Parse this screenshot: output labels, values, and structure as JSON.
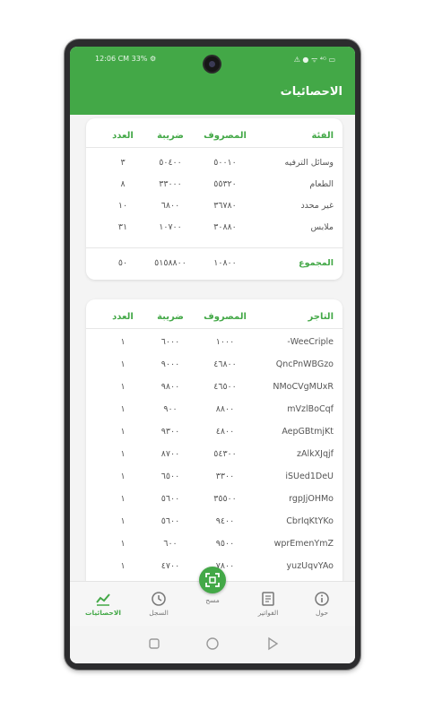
{
  "status": {
    "left": "12:06 CM 33% ⚙",
    "right": "⚠ ● ᯤ ⁴ᴳ ▭"
  },
  "appbar": {
    "title": "الاحصائيات"
  },
  "categories": {
    "headers": {
      "category": "الفئة",
      "expense": "المصروف",
      "tax": "ضريبة",
      "count": "العدد"
    },
    "rows": [
      {
        "category": "وسائل الترفيه",
        "expense": "٥٠٠١٠",
        "tax": "٥٠٤٠٠",
        "count": "٣"
      },
      {
        "category": "الطعام",
        "expense": "٥٥٣٢٠",
        "tax": "٣٣٠٠٠",
        "count": "٨"
      },
      {
        "category": "غير محدد",
        "expense": "٣٦٧٨٠",
        "tax": "٦٨٠٠",
        "count": "١٠"
      },
      {
        "category": "ملابس",
        "expense": "٣٠٨٨٠",
        "tax": "١٠٧٠٠",
        "count": "٣١"
      }
    ],
    "total": {
      "label": "المجموع",
      "expense": "١٠٨٠٠",
      "tax": "٥١٥٨٨٠٠",
      "count": "٥٠"
    }
  },
  "merchants": {
    "headers": {
      "merchant": "التاجر",
      "expense": "المصروف",
      "tax": "ضريبة",
      "count": "العدد"
    },
    "rows": [
      {
        "merchant": "WeeCriple-",
        "expense": "١٠٠٠",
        "tax": "٦٠٠٠",
        "count": "١"
      },
      {
        "merchant": "QncPnWBGzo",
        "expense": "٤٦٨٠٠",
        "tax": "٩٠٠٠",
        "count": "١"
      },
      {
        "merchant": "NMoCVgMUxR",
        "expense": "٤٦٥٠٠",
        "tax": "٩٨٠٠",
        "count": "١"
      },
      {
        "merchant": "mVzlBoCqf",
        "expense": "٨٨٠٠",
        "tax": "٩٠٠",
        "count": "١"
      },
      {
        "merchant": "AepGBtmjKt",
        "expense": "٤٨٠٠",
        "tax": "٩٣٠٠",
        "count": "١"
      },
      {
        "merchant": "zAlkXJqjf",
        "expense": "٥٤٣٠٠",
        "tax": "٨٧٠٠",
        "count": "١"
      },
      {
        "merchant": "iSUed1DeU",
        "expense": "٣٣٠٠",
        "tax": "٦٥٠٠",
        "count": "١"
      },
      {
        "merchant": "rgpJjOHMo",
        "expense": "٣٥٥٠٠",
        "tax": "٥٦٠٠",
        "count": "١"
      },
      {
        "merchant": "CbrIqKtYKo",
        "expense": "٩٤٠٠",
        "tax": "٥٦٠٠",
        "count": "١"
      },
      {
        "merchant": "wprEmenYmZ",
        "expense": "٩٥٠٠",
        "tax": "٦٠٠",
        "count": "١"
      },
      {
        "merchant": "yuzUqvYAo",
        "expense": "٧٨٠٠",
        "tax": "٤٧٠٠",
        "count": "١"
      }
    ]
  },
  "nav": {
    "stats": "الاحصائيات",
    "history": "السجل",
    "scan": "مسح",
    "invoices": "الفواتير",
    "about": "حول"
  },
  "colors": {
    "accent": "#43a847"
  }
}
